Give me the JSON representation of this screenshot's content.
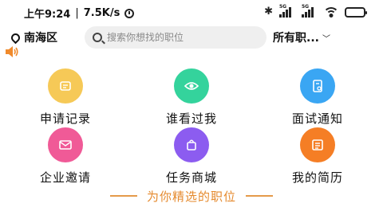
{
  "status_bar": {
    "time": "上午9:24",
    "network_speed": "7.5K/s",
    "signal_tag_1": "5G",
    "signal_tag_2": "5G",
    "icons": [
      "alarm-icon",
      "bluetooth-icon",
      "signal-icon",
      "signal-icon",
      "wifi-icon",
      "battery-icon"
    ]
  },
  "header": {
    "location": "南海区",
    "search_placeholder": "搜索你想找的职位",
    "filter_label": "所有职...",
    "filter_icon": "chevron-down-icon"
  },
  "grid": {
    "items": [
      {
        "label": "申请记录",
        "icon": "clipboard-icon",
        "color": "#f6c957"
      },
      {
        "label": "谁看过我",
        "icon": "eye-icon",
        "color": "#34d39c"
      },
      {
        "label": "面试通知",
        "icon": "document-icon",
        "color": "#3aa6f3"
      },
      {
        "label": "企业邀请",
        "icon": "envelope-icon",
        "color": "#f05a97"
      },
      {
        "label": "任务商城",
        "icon": "shopping-bag-icon",
        "color": "#8c5cf0"
      },
      {
        "label": "我的简历",
        "icon": "resume-icon",
        "color": "#f57e25"
      }
    ]
  },
  "section": {
    "title": "为你精选的职位",
    "accent_color": "#e58a2e"
  }
}
